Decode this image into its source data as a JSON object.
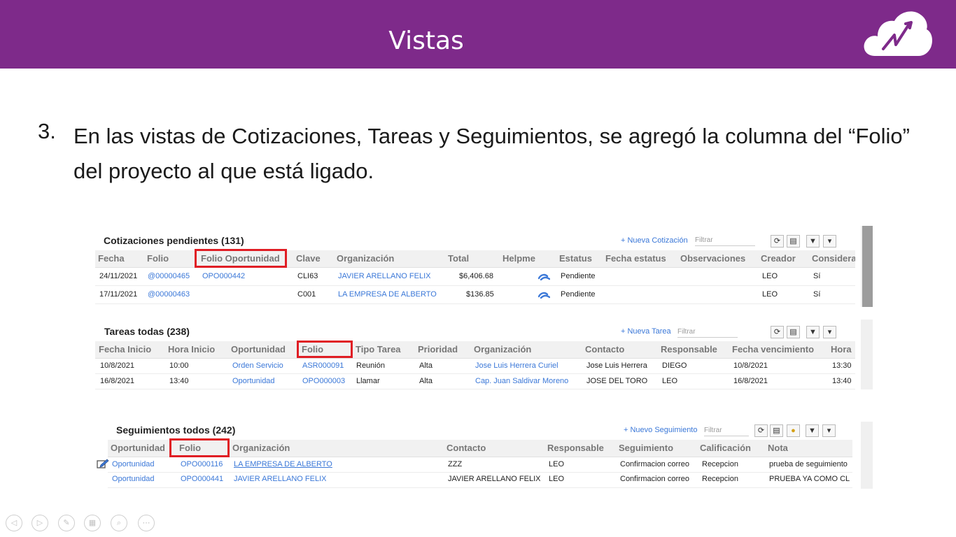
{
  "slide": {
    "title": "Vistas",
    "item_number": "3.",
    "item_text": "En las vistas de Cotizaciones, Tareas y Seguimientos, se agregó la columna del “Folio” del proyecto al que está ligado."
  },
  "colors": {
    "banner": "#7e2a8a",
    "link": "#3b78d8",
    "highlight": "#e01e25"
  },
  "cotizaciones": {
    "title": "Cotizaciones pendientes (131)",
    "new_label": "+ Nueva Cotización",
    "filter_placeholder": "Filtrar",
    "headers": [
      "Fecha",
      "Folio",
      "Folio Oportunidad",
      "Clave",
      "Organización",
      "Total",
      "Helpme",
      "Estatus",
      "Fecha estatus",
      "Observaciones",
      "Creador",
      "Considera"
    ],
    "rows": [
      {
        "fecha": "24/11/2021",
        "folio": "@00000465",
        "folio_oportunidad": "OPO000442",
        "clave": "CLI63",
        "organizacion": "JAVIER ARELLANO FELIX",
        "total": "$6,406.68",
        "estatus": "Pendiente",
        "creador": "LEO",
        "considera": "Sí"
      },
      {
        "fecha": "17/11/2021",
        "folio": "@00000463",
        "folio_oportunidad": "",
        "clave": "C001",
        "organizacion": "LA EMPRESA DE ALBERTO",
        "total": "$136.85",
        "estatus": "Pendiente",
        "creador": "LEO",
        "considera": "Sí"
      }
    ]
  },
  "tareas": {
    "title": "Tareas todas (238)",
    "new_label": "+ Nueva Tarea",
    "filter_placeholder": "Filtrar",
    "headers": [
      "Fecha Inicio",
      "Hora Inicio",
      "Oportunidad",
      "Folio",
      "Tipo Tarea",
      "Prioridad",
      "Organización",
      "Contacto",
      "Responsable",
      "Fecha vencimiento",
      "Hora"
    ],
    "rows": [
      {
        "fecha_inicio": "10/8/2021",
        "hora_inicio": "10:00",
        "oportunidad": "Orden Servicio",
        "folio": "ASR000091",
        "tipo": "Reunión",
        "prioridad": "Alta",
        "organizacion": "Jose Luis Herrera Curiel",
        "contacto": "Jose Luis Herrera",
        "responsable": "DIEGO",
        "vencimiento": "10/8/2021",
        "hora": "13:30"
      },
      {
        "fecha_inicio": "16/8/2021",
        "hora_inicio": "13:40",
        "oportunidad": "Oportunidad",
        "folio": "OPO000003",
        "tipo": "Llamar",
        "prioridad": "Alta",
        "organizacion": "Cap. Juan Saldivar Moreno",
        "contacto": "JOSE DEL TORO",
        "responsable": "LEO",
        "vencimiento": "16/8/2021",
        "hora": "13:40"
      }
    ]
  },
  "seguimientos": {
    "title": "Seguimientos todos (242)",
    "new_label": "+ Nuevo Seguimiento",
    "filter_placeholder": "Filtrar",
    "headers": [
      "Oportunidad",
      "Folio",
      "Organización",
      "Contacto",
      "Responsable",
      "Seguimiento",
      "Calificación",
      "Nota"
    ],
    "rows": [
      {
        "oportunidad": "Oportunidad",
        "folio": "OPO000116",
        "organizacion": "LA EMPRESA DE ALBERTO",
        "contacto": "ZZZ",
        "responsable": "LEO",
        "seguimiento": "Confirmacion correo",
        "calificacion": "Recepcion",
        "nota": "prueba de seguimiento"
      },
      {
        "oportunidad": "Oportunidad",
        "folio": "OPO000441",
        "organizacion": "JAVIER ARELLANO FELIX",
        "contacto": "JAVIER ARELLANO FELIX",
        "responsable": "LEO",
        "seguimiento": "Confirmacion correo",
        "calificacion": "Recepcion",
        "nota": "PRUEBA YA COMO CL"
      }
    ]
  },
  "icons": {
    "refresh": "refresh-icon",
    "export": "export-icon",
    "filter": "funnel-icon",
    "dropdown": "chevron-down-icon",
    "map": "map-pin-icon",
    "helpme": "swirl-icon",
    "edit": "edit-icon",
    "logo": "cloud-logo"
  },
  "nav": {
    "prev": "◁",
    "next": "▷",
    "pen": "✎",
    "grid": "▦",
    "zoom": "⌕",
    "more": "⋯"
  }
}
